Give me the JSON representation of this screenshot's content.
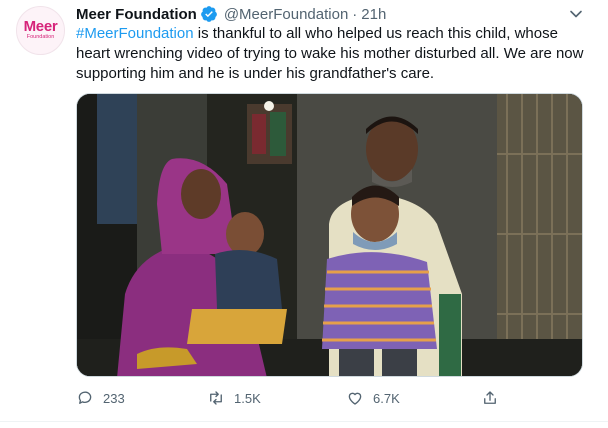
{
  "tweet": {
    "avatar_text_main": "Meer",
    "avatar_text_sub": "Foundation",
    "display_name": "Meer Foundation",
    "handle": "@MeerFoundation",
    "separator": "·",
    "time": "21h",
    "hashtag": "#MeerFoundation",
    "text": " is thankful to all who helped us reach this child, whose heart wrenching video of trying to wake his mother disturbed all. We are now supporting him and he is under his grandfather's care.",
    "colors": {
      "link": "#1d9bf0",
      "brand": "#d6247a",
      "muted": "#536471"
    }
  },
  "actions": {
    "reply": {
      "icon": "reply-icon",
      "count": "233"
    },
    "retweet": {
      "icon": "retweet-icon",
      "count": "1.5K"
    },
    "like": {
      "icon": "heart-icon",
      "count": "6.7K"
    },
    "share": {
      "icon": "share-icon"
    }
  }
}
